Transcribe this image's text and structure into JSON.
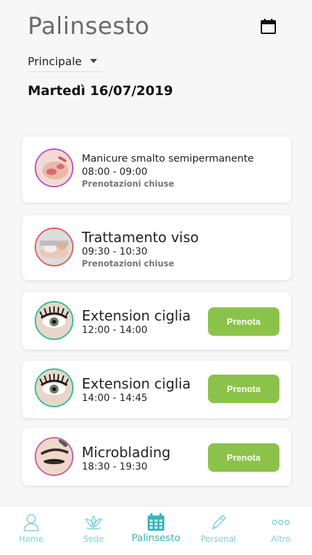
{
  "header": {
    "title": "Palinsesto",
    "calendar_icon": "calendar-icon"
  },
  "filter": {
    "selected": "Principale"
  },
  "date_label": "Martedì 16/07/2019",
  "events": [
    {
      "title": "Manicure smalto semipermanente",
      "time": "08:00 - 09:00",
      "status": "Prenotazioni chiuse",
      "ring_color": "#b455c4",
      "bookable": false
    },
    {
      "title": "Trattamento viso",
      "time": "09:30 - 10:30",
      "status": "Prenotazioni chiuse",
      "ring_color": "#e45b5b",
      "bookable": false
    },
    {
      "title": "Extension ciglia",
      "time": "12:00 - 14:00",
      "ring_color": "#2fbf8f",
      "bookable": true,
      "button": "Prenota"
    },
    {
      "title": "Extension ciglia",
      "time": "14:00 - 14:45",
      "ring_color": "#2fbf8f",
      "bookable": true,
      "button": "Prenota"
    },
    {
      "title": "Microblading",
      "time": "18:30 - 19:30",
      "ring_color": "#c45bb3",
      "bookable": true,
      "button": "Prenota"
    }
  ],
  "nav": [
    {
      "label": "Home",
      "icon": "person-icon",
      "active": false
    },
    {
      "label": "Sede",
      "icon": "lotus-icon",
      "active": false
    },
    {
      "label": "Palinsesto",
      "icon": "calendar-grid-icon",
      "active": true
    },
    {
      "label": "Personal",
      "icon": "pencil-icon",
      "active": false
    },
    {
      "label": "Altro",
      "icon": "more-icon",
      "active": false
    }
  ],
  "colors": {
    "accent": "#38b6bd",
    "accent_light": "#7fd1d6",
    "book_button": "#8bc34a"
  }
}
